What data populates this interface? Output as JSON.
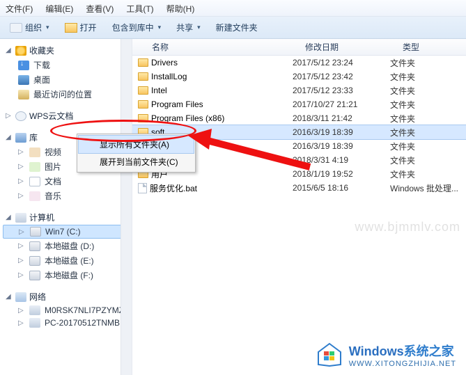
{
  "menubar": {
    "file": "文件(F)",
    "edit": "编辑(E)",
    "view": "查看(V)",
    "tools": "工具(T)",
    "help": "帮助(H)"
  },
  "toolbar": {
    "organize": "组织",
    "open": "打开",
    "include": "包含到库中",
    "share": "共享",
    "newfolder": "新建文件夹"
  },
  "columns": {
    "name": "名称",
    "modified": "修改日期",
    "type": "类型"
  },
  "sidebar": {
    "favorites": {
      "label": "收藏夹",
      "items": [
        {
          "label": "下载"
        },
        {
          "label": "桌面"
        },
        {
          "label": "最近访问的位置"
        }
      ]
    },
    "cloud": {
      "label": "WPS云文档"
    },
    "libraries": {
      "label": "库",
      "items": [
        {
          "label": "视频"
        },
        {
          "label": "图片"
        },
        {
          "label": "文档"
        },
        {
          "label": "音乐"
        }
      ]
    },
    "computer": {
      "label": "计算机",
      "items": [
        {
          "label": "Win7 (C:)"
        },
        {
          "label": "本地磁盘 (D:)"
        },
        {
          "label": "本地磁盘 (E:)"
        },
        {
          "label": "本地磁盘 (F:)"
        }
      ]
    },
    "network": {
      "label": "网络",
      "items": [
        {
          "label": "M0RSK7NLI7PZYMZ"
        },
        {
          "label": "PC-20170512TNMB"
        }
      ]
    }
  },
  "rows": [
    {
      "name": "Drivers",
      "date": "2017/5/12 23:24",
      "type": "文件夹",
      "kind": "folder",
      "sel": false
    },
    {
      "name": "InstallLog",
      "date": "2017/5/12 23:42",
      "type": "文件夹",
      "kind": "folder",
      "sel": false
    },
    {
      "name": "Intel",
      "date": "2017/5/12 23:33",
      "type": "文件夹",
      "kind": "folder",
      "sel": false
    },
    {
      "name": "Program Files",
      "date": "2017/10/27 21:21",
      "type": "文件夹",
      "kind": "folder",
      "sel": false
    },
    {
      "name": "Program Files (x86)",
      "date": "2018/3/11 21:42",
      "type": "文件夹",
      "kind": "folder",
      "sel": false
    },
    {
      "name": "soft",
      "date": "2016/3/19 18:39",
      "type": "文件夹",
      "kind": "folder",
      "sel": true
    },
    {
      "name": "",
      "date": "2016/3/19 18:39",
      "type": "文件夹",
      "kind": "folder",
      "sel": false
    },
    {
      "name": "",
      "date": "2018/3/31 4:19",
      "type": "文件夹",
      "kind": "folder",
      "sel": false
    },
    {
      "name": "用户",
      "date": "2018/1/19 19:52",
      "type": "文件夹",
      "kind": "folder",
      "sel": false
    },
    {
      "name": "服务优化.bat",
      "date": "2015/6/5 18:16",
      "type": "Windows 批处理...",
      "kind": "file",
      "sel": false
    }
  ],
  "context_menu": {
    "items": [
      {
        "label": "显示所有文件夹(A)",
        "hov": true
      },
      {
        "label": "展开到当前文件夹(C)",
        "hov": false
      }
    ]
  },
  "watermark": "www.bjmmlv.com",
  "brand": {
    "line1a": "Windows",
    "line1b": "系统之家",
    "line2": "WWW.XITONGZHIJIA.NET"
  }
}
